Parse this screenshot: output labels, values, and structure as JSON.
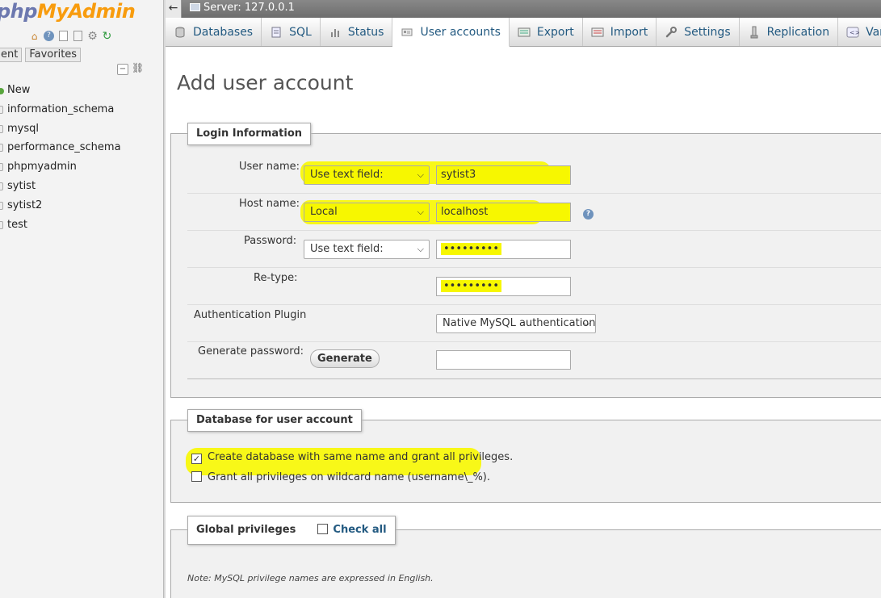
{
  "sidebar": {
    "logo_php": "php",
    "logo_myadmin": "MyAdmin",
    "nav_icons": [
      "home-icon",
      "help-icon",
      "docs-icon",
      "settings-icon",
      "reload-icon"
    ],
    "tabs": [
      {
        "label": "ent"
      },
      {
        "label": "Favorites"
      }
    ],
    "new_label": "New",
    "databases": [
      "information_schema",
      "mysql",
      "performance_schema",
      "phpmyadmin",
      "sytist",
      "sytist2",
      "test"
    ]
  },
  "topbar": {
    "collapse_arrow": "←",
    "server": "Server: 127.0.0.1"
  },
  "menu": {
    "tabs": [
      {
        "label": "Databases",
        "icon": "database-icon"
      },
      {
        "label": "SQL",
        "icon": "sql-icon"
      },
      {
        "label": "Status",
        "icon": "status-icon"
      },
      {
        "label": "User accounts",
        "icon": "users-icon",
        "active": true
      },
      {
        "label": "Export",
        "icon": "export-icon"
      },
      {
        "label": "Import",
        "icon": "import-icon"
      },
      {
        "label": "Settings",
        "icon": "wrench-icon"
      },
      {
        "label": "Replication",
        "icon": "replication-icon"
      },
      {
        "label": "Variab",
        "icon": "variables-icon"
      }
    ]
  },
  "page": {
    "title": "Add user account"
  },
  "login": {
    "legend": "Login Information",
    "user_name_label": "User name:",
    "user_name_select": "Use text field:",
    "user_name_value": "sytist3",
    "host_name_label": "Host name:",
    "host_name_select": "Local",
    "host_name_value": "localhost",
    "password_label": "Password:",
    "password_select": "Use text field:",
    "password_value": "•••••••••",
    "retype_label": "Re-type:",
    "retype_value": "•••••••••",
    "auth_plugin_label": "Authentication Plugin",
    "auth_plugin_value": "Native MySQL authentication",
    "generate_label": "Generate password:",
    "generate_button": "Generate",
    "generate_value": ""
  },
  "database": {
    "legend": "Database for user account",
    "create_db_label": "Create database with same name and grant all privileges.",
    "create_db_checked": true,
    "wildcard_label": "Grant all privileges on wildcard name (username\\_%).",
    "wildcard_checked": false
  },
  "global": {
    "legend": "Global privileges",
    "check_all": "Check all",
    "note": "Note: MySQL privilege names are expressed in English."
  },
  "colors": {
    "highlight": "#f7f700",
    "link": "#235a81",
    "logo_blue": "#6c78af",
    "logo_orange": "#f89c0e"
  }
}
